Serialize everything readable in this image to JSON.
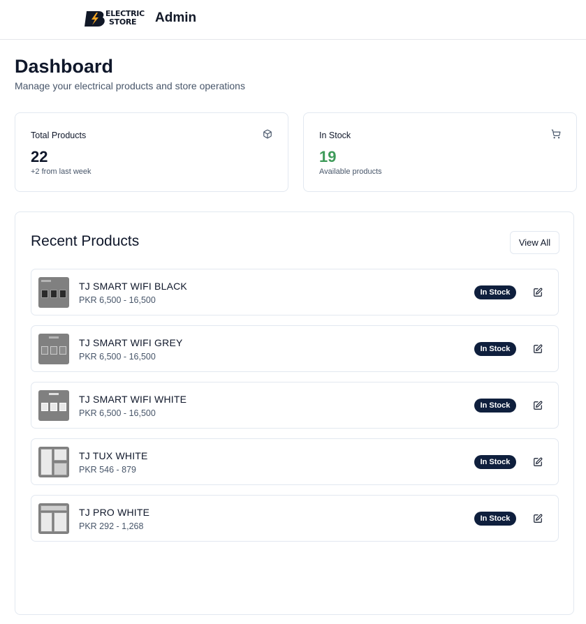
{
  "header": {
    "logo_line1": "ELECTRIC",
    "logo_line2": "STORE",
    "title": "Admin"
  },
  "page": {
    "title": "Dashboard",
    "subtitle": "Manage your electrical products and store operations"
  },
  "stats": [
    {
      "label": "Total Products",
      "value": "22",
      "note": "+2 from last week",
      "icon": "package-icon"
    },
    {
      "label": "In Stock",
      "value": "19",
      "note": "Available products",
      "icon": "shopping-cart-icon",
      "value_color": "#3f9b5a"
    }
  ],
  "recent": {
    "title": "Recent Products",
    "view_all_label": "View All",
    "items": [
      {
        "name": "TJ SMART WIFI BLACK",
        "price": "PKR 6,500 - 16,500",
        "status": "In Stock",
        "thumb": "dark"
      },
      {
        "name": "TJ SMART WIFI GREY",
        "price": "PKR 6,500 - 16,500",
        "status": "In Stock",
        "thumb": "grey"
      },
      {
        "name": "TJ SMART WIFI WHITE",
        "price": "PKR 6,500 - 16,500",
        "status": "In Stock",
        "thumb": "white"
      },
      {
        "name": "TJ TUX WHITE",
        "price": "PKR 546 - 879",
        "status": "In Stock",
        "thumb": "tux"
      },
      {
        "name": "TJ PRO WHITE",
        "price": "PKR 292 - 1,268",
        "status": "In Stock",
        "thumb": "pro"
      }
    ]
  },
  "colors": {
    "badge_bg": "#0f1f3d",
    "accent_green": "#3f9b5a",
    "logo_orange": "#f5a623",
    "border": "#e2e8f0"
  }
}
